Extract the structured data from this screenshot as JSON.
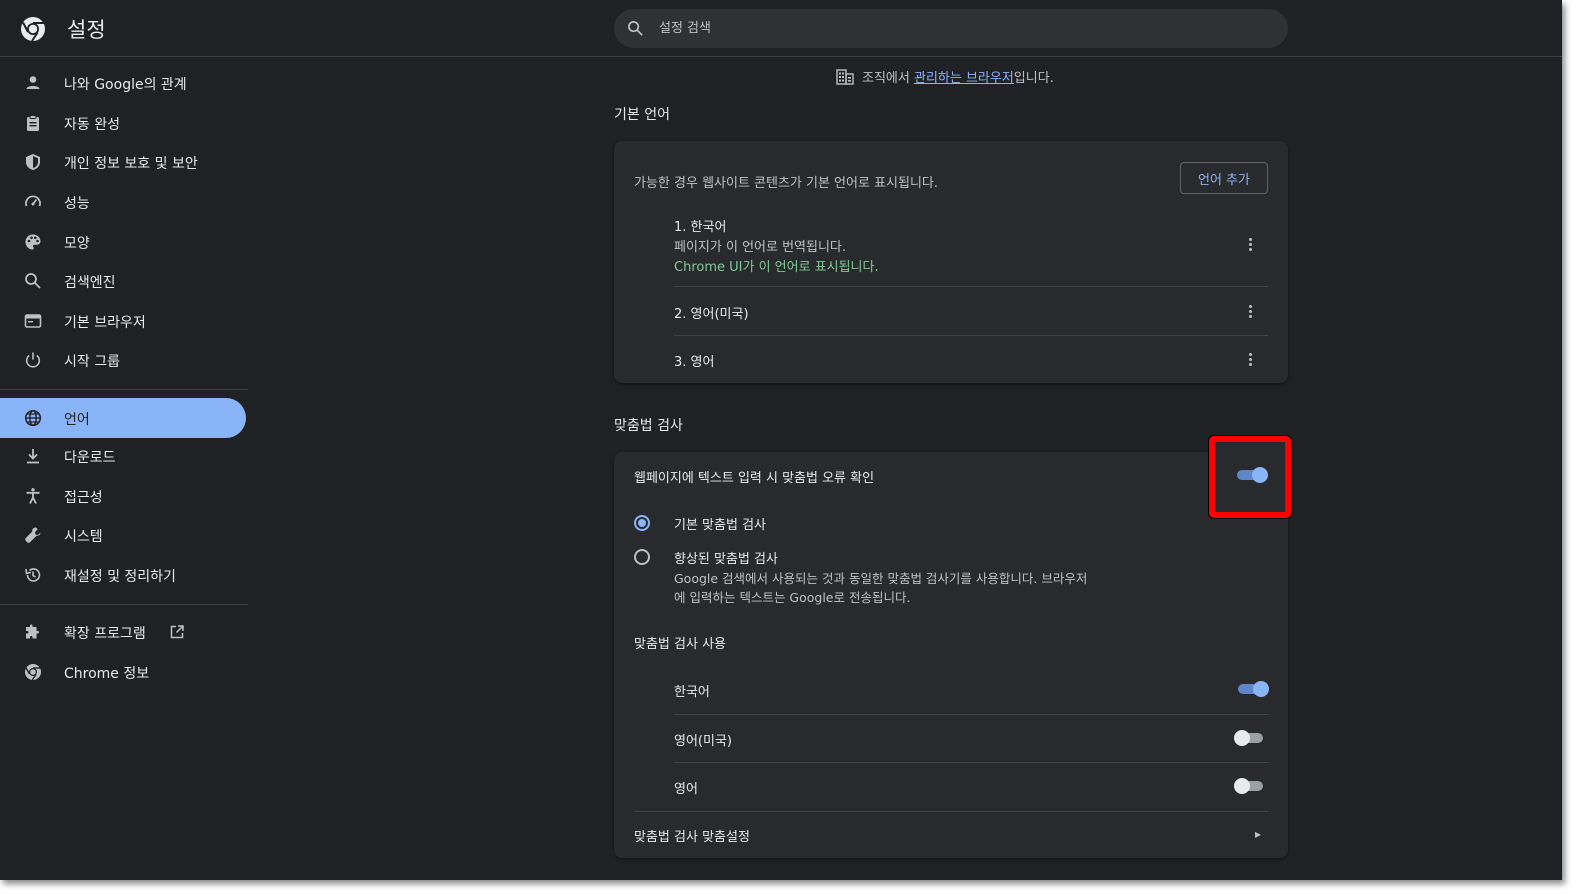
{
  "header": {
    "title": "설정",
    "search_placeholder": "설정 검색"
  },
  "sidebar": {
    "items": [
      {
        "label": "나와 Google의 관계",
        "icon": "person-icon"
      },
      {
        "label": "자동 완성",
        "icon": "clipboard-icon"
      },
      {
        "label": "개인 정보 보호 및 보안",
        "icon": "shield-icon"
      },
      {
        "label": "성능",
        "icon": "speedometer-icon"
      },
      {
        "label": "모양",
        "icon": "palette-icon"
      },
      {
        "label": "검색엔진",
        "icon": "search-icon"
      },
      {
        "label": "기본 브라우저",
        "icon": "browser-icon"
      },
      {
        "label": "시작 그룹",
        "icon": "power-icon"
      },
      {
        "label": "언어",
        "icon": "globe-icon",
        "active": true
      },
      {
        "label": "다운로드",
        "icon": "download-icon"
      },
      {
        "label": "접근성",
        "icon": "accessibility-icon"
      },
      {
        "label": "시스템",
        "icon": "wrench-icon"
      },
      {
        "label": "재설정 및 정리하기",
        "icon": "reset-icon"
      },
      {
        "label": "확장 프로그램",
        "icon": "puzzle-icon"
      },
      {
        "label": "Chrome 정보",
        "icon": "chrome-icon"
      }
    ]
  },
  "managed": {
    "prefix": "조직에서 ",
    "link": "관리하는 브라우저",
    "suffix": "입니다."
  },
  "preferred_languages": {
    "title": "기본 언어",
    "description": "가능한 경우 웹사이트 콘텐츠가 기본 언어로 표시됩니다.",
    "add_button": "언어 추가",
    "languages": [
      {
        "name": "1. 한국어",
        "note1": "페이지가 이 언어로 번역됩니다.",
        "note2": "Chrome UI가 이 언어로 표시됩니다."
      },
      {
        "name": "2. 영어(미국)"
      },
      {
        "name": "3. 영어"
      }
    ]
  },
  "spell_check": {
    "title": "맞춤법 검사",
    "toggle_label": "웹페이지에 텍스트 입력 시 맞춤법 오류 확인",
    "toggle_on": true,
    "basic_label": "기본 맞춤법 검사",
    "enhanced_label": "향상된 맞춤법 검사",
    "enhanced_desc1": "Google 검색에서 사용되는 것과 동일한 맞춤법 검사기를 사용합니다. 브라우저",
    "enhanced_desc2": "에 입력하는 텍스트는 Google로 전송됩니다.",
    "selected": "basic",
    "use_title": "맞춤법 검사 사용",
    "languages": [
      {
        "name": "한국어",
        "on": true
      },
      {
        "name": "영어(미국)",
        "on": false
      },
      {
        "name": "영어",
        "on": false
      }
    ],
    "customize_label": "맞춤법 검사 맞춤설정"
  },
  "colors": {
    "background": "#202124",
    "card": "#292a2d",
    "accent": "#8ab4f8",
    "highlight": "#ff0000",
    "green": "#81c995"
  }
}
